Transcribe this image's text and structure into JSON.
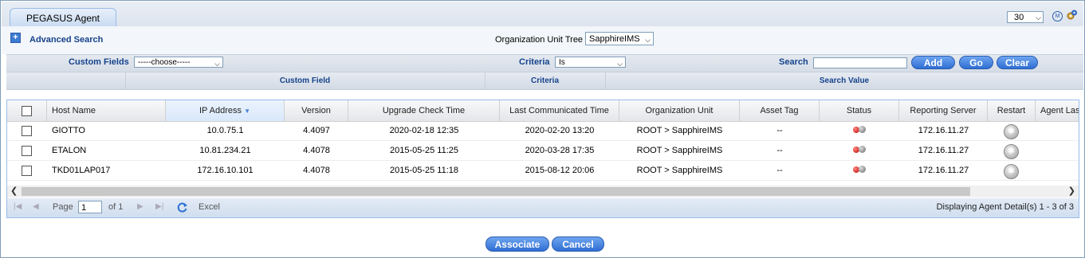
{
  "header": {
    "tab_title": "PEGASUS Agent",
    "page_size": "30",
    "m_icon_text": "M"
  },
  "search": {
    "advanced_label": "Advanced Search",
    "org_tree_label": "Organization Unit Tree",
    "org_tree_value": "SapphireIMS",
    "custom_fields_label": "Custom Fields",
    "custom_fields_value": "-----choose-----",
    "criteria_label": "Criteria",
    "criteria_value": "Is",
    "search_label": "Search",
    "search_value": "",
    "add_label": "Add",
    "go_label": "Go",
    "clear_label": "Clear"
  },
  "custom_grid": {
    "columns": [
      "Custom Field",
      "Criteria",
      "Search Value"
    ]
  },
  "grid": {
    "columns": [
      "Host Name",
      "IP Address",
      "Version",
      "Upgrade Check Time",
      "Last Communicated Time",
      "Organization Unit",
      "Asset Tag",
      "Status",
      "Reporting Server",
      "Restart",
      "Agent Las"
    ],
    "rows": [
      {
        "host": "GIOTTO",
        "ip": "10.0.75.1",
        "version": "4.4097",
        "upgrade": "2020-02-18 12:35",
        "last": "2020-02-20 13:20",
        "org": "ROOT > SapphireIMS",
        "asset": "--",
        "server": "172.16.11.27"
      },
      {
        "host": "ETALON",
        "ip": "10.81.234.21",
        "version": "4.4078",
        "upgrade": "2015-05-25 11:25",
        "last": "2020-03-28 17:35",
        "org": "ROOT > SapphireIMS",
        "asset": "--",
        "server": "172.16.11.27"
      },
      {
        "host": "TKD01LAP017",
        "ip": "172.16.10.101",
        "version": "4.4078",
        "upgrade": "2015-05-25 11:18",
        "last": "2015-08-12 20:06",
        "org": "ROOT > SapphireIMS",
        "asset": "--",
        "server": "172.16.11.27"
      }
    ]
  },
  "paging": {
    "page_label": "Page",
    "page_value": "1",
    "of_label": "of 1",
    "excel_label": "Excel",
    "display_text": "Displaying Agent Detail(s) 1 - 3 of 3"
  },
  "footer": {
    "associate_label": "Associate",
    "cancel_label": "Cancel"
  },
  "colors": {
    "accent": "#2f6ed3",
    "header_text": "#15428b",
    "status_red": "#c00000"
  }
}
